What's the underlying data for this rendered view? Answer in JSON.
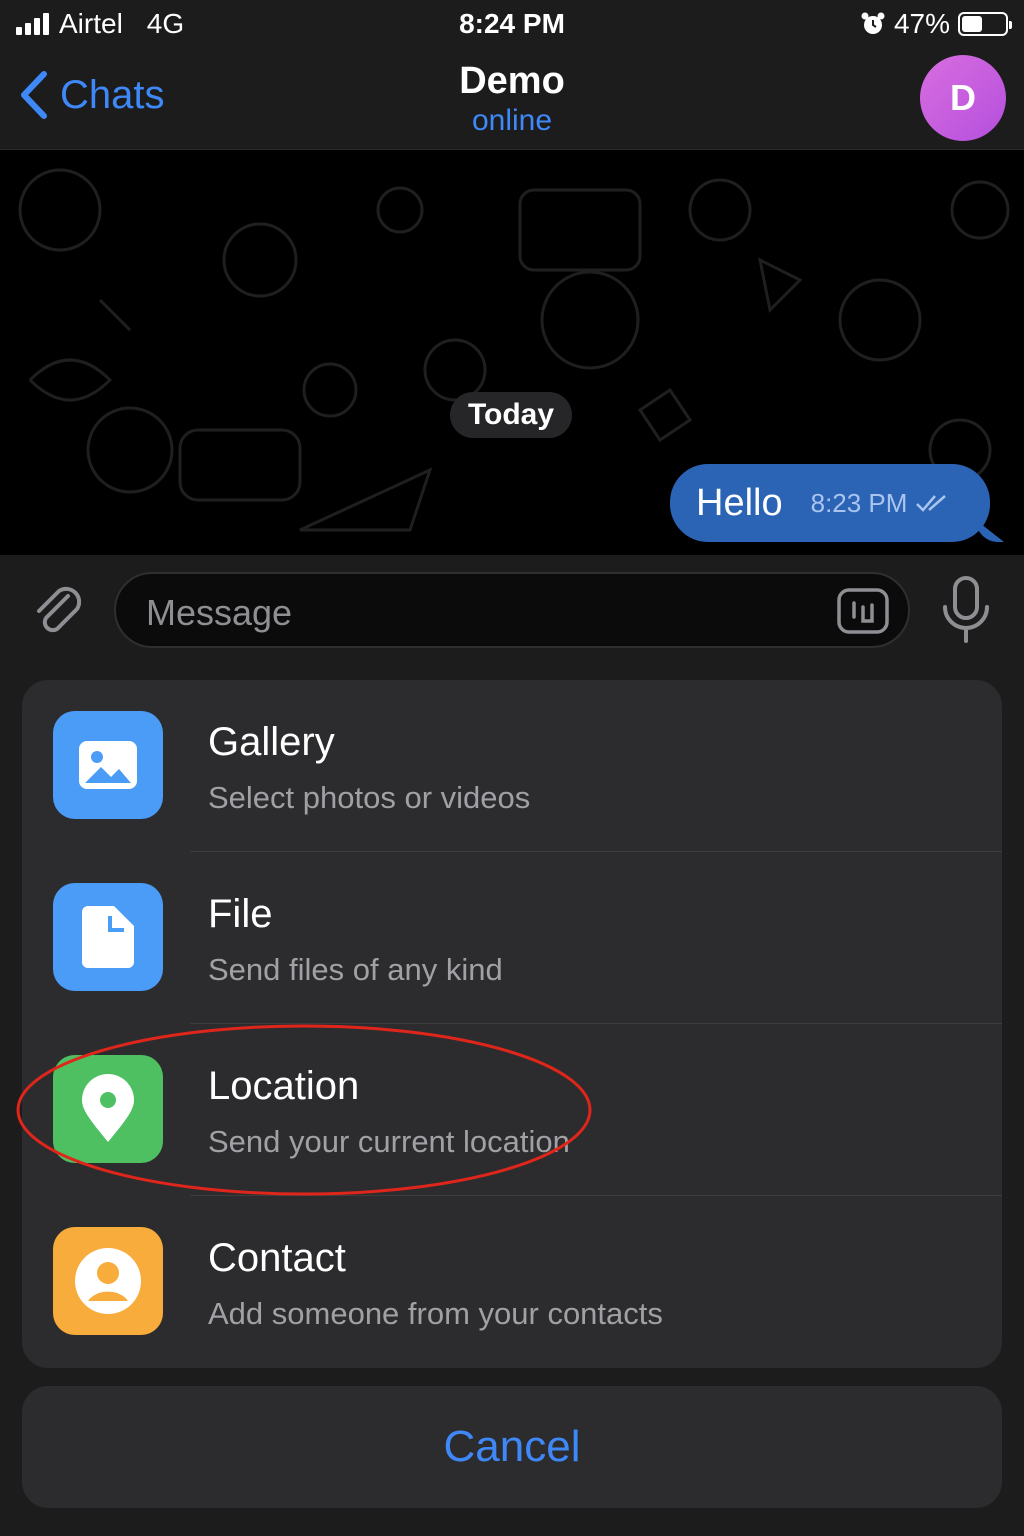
{
  "status_bar": {
    "carrier": "Airtel",
    "network": "4G",
    "time": "8:24 PM",
    "battery": "47%"
  },
  "nav": {
    "back_label": "Chats",
    "title": "Demo",
    "subtitle": "online",
    "avatar_initial": "D"
  },
  "chat": {
    "date_divider": "Today",
    "messages": [
      {
        "text": "Hello",
        "time": "8:23 PM"
      }
    ]
  },
  "input": {
    "placeholder": "Message"
  },
  "attach_menu": {
    "items": [
      {
        "title": "Gallery",
        "subtitle": "Select photos or videos",
        "icon": "image-icon",
        "color": "#4a9cf6"
      },
      {
        "title": "File",
        "subtitle": "Send files of any kind",
        "icon": "file-icon",
        "color": "#4a9cf6"
      },
      {
        "title": "Location",
        "subtitle": "Send your current location",
        "icon": "location-pin-icon",
        "color": "#4fc062"
      },
      {
        "title": "Contact",
        "subtitle": "Add someone from your contacts",
        "icon": "person-icon",
        "color": "#f8ac3b"
      }
    ],
    "cancel_label": "Cancel"
  },
  "colors": {
    "accent": "#3e88f7",
    "bubble": "#2b64b5",
    "annotation": "#e0251b"
  }
}
